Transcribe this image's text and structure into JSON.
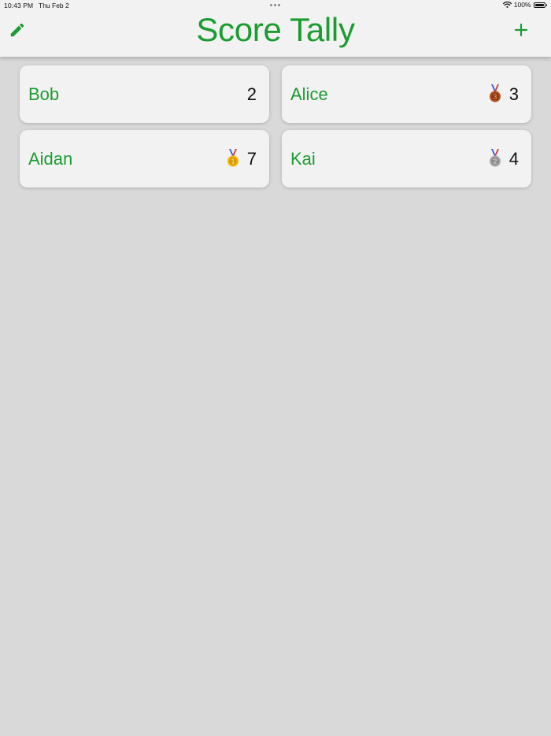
{
  "status_bar": {
    "time": "10:43 PM",
    "date": "Thu Feb 2",
    "battery": "100%"
  },
  "header": {
    "title": "Score Tally",
    "edit_icon": "pencil-icon",
    "add_label": "+"
  },
  "colors": {
    "accent": "#1b9c30",
    "background": "#d9d9d9",
    "card": "#f2f2f2"
  },
  "players": [
    {
      "name": "Bob",
      "score": "2",
      "medal": null
    },
    {
      "name": "Alice",
      "score": "3",
      "medal": "bronze",
      "medal_label": "3"
    },
    {
      "name": "Aidan",
      "score": "7",
      "medal": "gold",
      "medal_label": "1"
    },
    {
      "name": "Kai",
      "score": "4",
      "medal": "silver",
      "medal_label": "2"
    }
  ]
}
